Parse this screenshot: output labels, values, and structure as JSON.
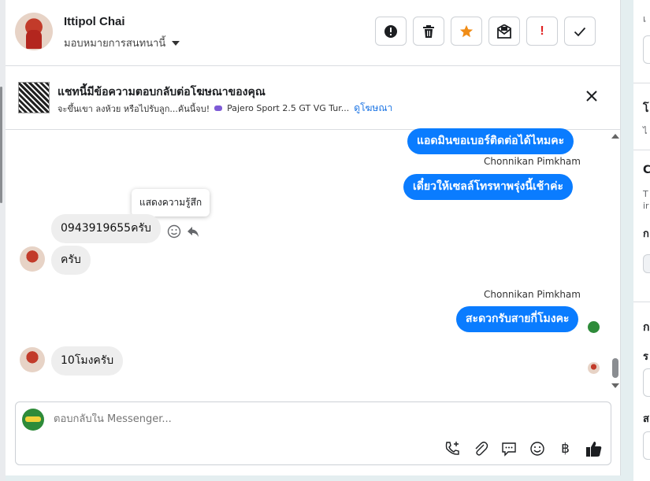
{
  "header": {
    "user_name": "Ittipol Chai",
    "assign_label": "มอบหมายการสนทนานี้",
    "actions": [
      "report-icon",
      "trash-icon",
      "star-icon",
      "mark-unread-icon",
      "spam-icon",
      "done-icon"
    ]
  },
  "banner": {
    "title": "แชทนี้มีข้อความตอบกลับต่อโฆษณาของคุณ",
    "ad_text": "จะขึ้นเขา ลงห้วย หรือไปรับลูก...คันนี้จบ!",
    "ad_product": "Pajero Sport 2.5 GT VG Tur...",
    "view_ad_link": "ดูโฆษณา"
  },
  "messages": {
    "out1": "แอดมินขอเบอร์ติดต่อได้ไหมคะ",
    "sender1": "Chonnikan Pimkham",
    "out2": "เดี๋ยวให้เซลล์โทรหาพรุ่งนี้เช้าค่ะ",
    "tooltip": "แสดงความรู้สึก",
    "in1": "0943919655ครับ",
    "in2": "ครับ",
    "sender2": "Chonnikan Pimkham",
    "out3": "สะดวกรับสายกี่โมงคะ",
    "in3": "10โมงครับ"
  },
  "composer": {
    "placeholder": "ตอบกลับใน Messenger..."
  },
  "right_panel": {
    "t1": "เ",
    "t2": "โ",
    "t3": "ไ",
    "t4": "C",
    "t5": "T",
    "t6": "ir",
    "t7": "ก",
    "t8": "ก",
    "t9": "ร",
    "t10": "ส"
  },
  "colors": {
    "accent": "#0a7cff",
    "link": "#1b74e4",
    "star": "#f08c16",
    "spam": "#e02020"
  }
}
